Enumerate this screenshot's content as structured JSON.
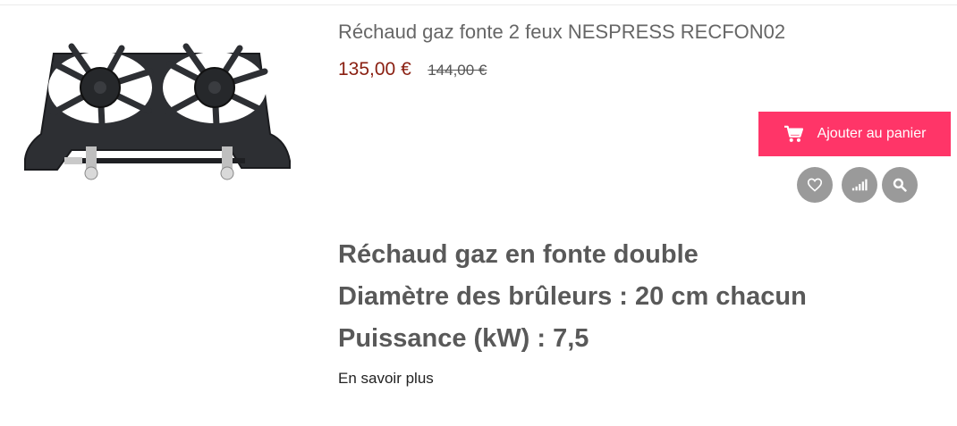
{
  "product": {
    "title": "Réchaud gaz fonte 2 feux NESPRESS RECFON02",
    "price_current": "135,00 €",
    "price_old": "144,00 €",
    "image_alt": "Réchaud gaz fonte 2 feux",
    "description_lines": [
      "Réchaud gaz en fonte double",
      "Diamètre des brûleurs : 20 cm chacun",
      "Puissance (kW) : 7,5"
    ],
    "more_link": "En savoir plus"
  },
  "actions": {
    "add_to_cart_label": "Ajouter au panier",
    "add_to_cart_icon": "cart-icon",
    "wishlist_icon": "heart-icon",
    "compare_icon": "signal-bars-icon",
    "quickview_icon": "search-icon"
  },
  "colors": {
    "accent": "#ff3568",
    "price": "#8a1f11",
    "action_circle": "#9a9a9a"
  }
}
